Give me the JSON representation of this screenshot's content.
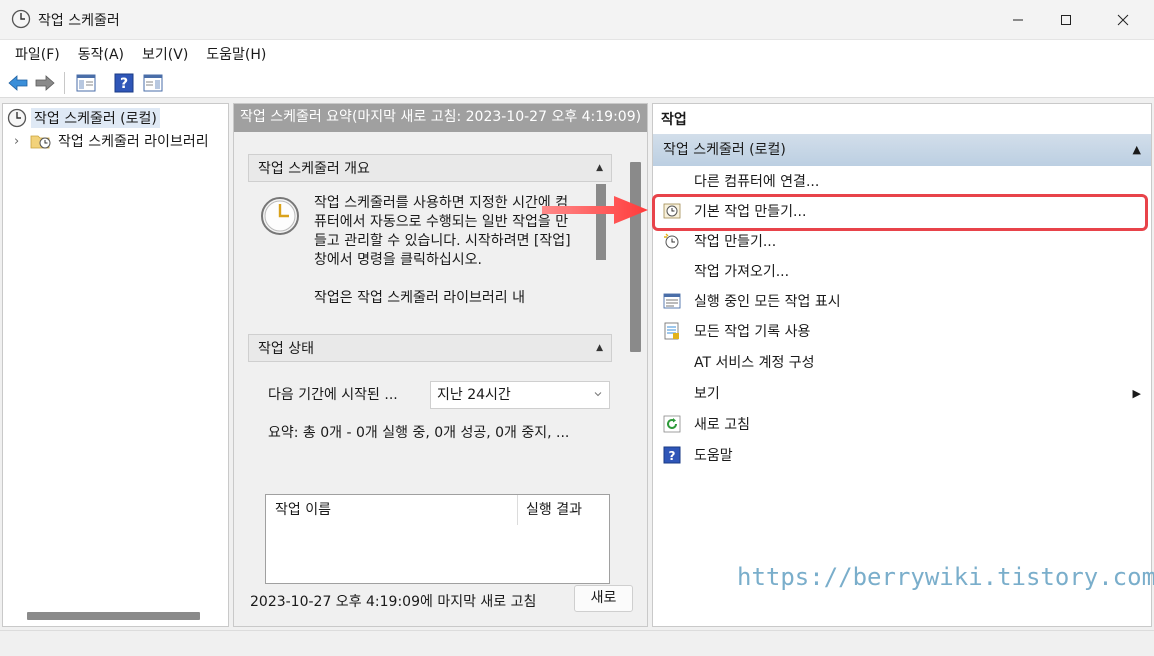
{
  "window": {
    "title": "작업 스케줄러"
  },
  "menu": [
    "파일(F)",
    "동작(A)",
    "보기(V)",
    "도움말(H)"
  ],
  "tree": {
    "root": "작업 스케줄러 (로컬)",
    "child": "작업 스케줄러 라이브러리",
    "child_expander": "›"
  },
  "center": {
    "header": "작업 스케줄러 요약(마지막 새로 고침: 2023-10-27 오후 4:19:09)",
    "overview_title": "작업 스케줄러 개요",
    "overview_p1": "작업 스케줄러를 사용하면 지정한 시간에 컴퓨터에서 자동으로 수행되는 일반 작업을 만들고 관리할 수 있습니다. 시작하려면 [작업] 창에서 명령을 클릭하십시오.",
    "overview_p2": "작업은 작업 스케줄러 라이브러리 내",
    "status_title": "작업 상태",
    "period_label": "다음 기간에 시작된 ...",
    "period_value": "지난 24시간",
    "summary": "요약: 총 0개 - 0개 실행 중, 0개 성공, 0개 중지, ...",
    "table_cols": [
      "작업 이름",
      "실행 결과"
    ],
    "footer": "2023-10-27 오후 4:19:09에 마지막 새로 고침",
    "refresh_btn": "새로"
  },
  "actions": {
    "title": "작업",
    "group": "작업 스케줄러 (로컬)",
    "items": [
      {
        "label": "다른 컴퓨터에 연결...",
        "icon": "none"
      },
      {
        "label": "기본 작업 만들기...",
        "icon": "clock-wizard-icon"
      },
      {
        "label": "작업 만들기...",
        "icon": "clock-new-icon"
      },
      {
        "label": "작업 가져오기...",
        "icon": "none"
      },
      {
        "label": "실행 중인 모든 작업 표시",
        "icon": "list-icon"
      },
      {
        "label": "모든 작업 기록 사용",
        "icon": "log-icon"
      },
      {
        "label": "AT 서비스 계정 구성",
        "icon": "none"
      },
      {
        "label": "보기",
        "icon": "none",
        "submenu": true
      },
      {
        "label": "새로 고침",
        "icon": "refresh-icon"
      },
      {
        "label": "도움말",
        "icon": "help-icon"
      }
    ]
  },
  "watermark": "https://berrywiki.tistory.com",
  "colors": {
    "highlight": "#e8434a",
    "group_bg": "#c5d6e8",
    "header_gray": "#a0a0a0"
  }
}
